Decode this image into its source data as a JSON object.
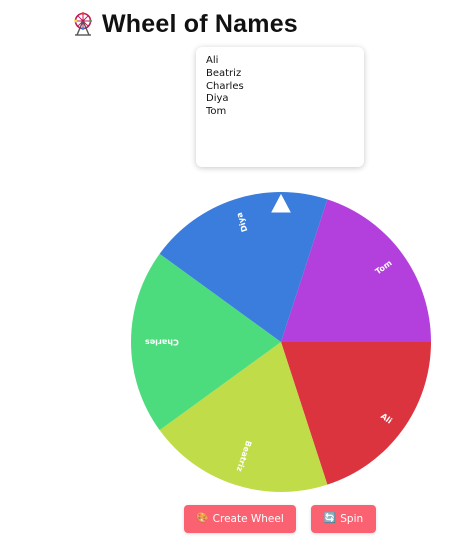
{
  "header": {
    "icon": "ferris-wheel-icon",
    "title": "Wheel of Names"
  },
  "names_box": {
    "names": [
      "Ali",
      "Beatriz",
      "Charles",
      "Diya",
      "Tom"
    ]
  },
  "wheel": {
    "pointer_icon": "triangle-pointer-icon",
    "segments": [
      {
        "label": "Tom",
        "color": "#b33fdc"
      },
      {
        "label": "Ali",
        "color": "#dc343e"
      },
      {
        "label": "Beatriz",
        "color": "#c0dc48"
      },
      {
        "label": "Charles",
        "color": "#4ddc7d"
      },
      {
        "label": "Diya",
        "color": "#3a7ddc"
      }
    ]
  },
  "buttons": {
    "create_icon": "palette-icon",
    "create_label": "Create Wheel",
    "spin_icon": "refresh-icon",
    "spin_label": "Spin",
    "color": "#fa6272"
  }
}
